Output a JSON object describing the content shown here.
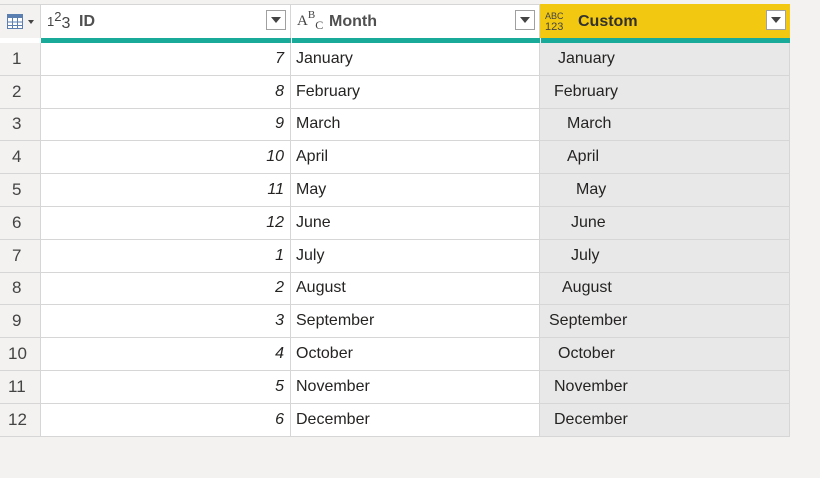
{
  "columns": [
    {
      "type_icon": "number-type-icon",
      "name": "ID"
    },
    {
      "type_icon": "text-type-icon",
      "name": "Month"
    },
    {
      "type_icon": "any-type-icon",
      "name": "Custom",
      "selected": true
    }
  ],
  "type_labels": {
    "number_a": "1",
    "number_b": "2",
    "number_c": "3",
    "text_a": "A",
    "text_b": "B",
    "text_c": "C",
    "any_top": "ABC",
    "any_bottom": "123"
  },
  "colors": {
    "selected_header": "#f2c811",
    "quality_bar": "#1aaa9a",
    "selected_column_bg": "#e8e8e8",
    "background": "#f3f2f1"
  },
  "rows": [
    {
      "n": "1",
      "id": "7",
      "month": "January",
      "custom": "January",
      "indent": 18
    },
    {
      "n": "2",
      "id": "8",
      "month": "February",
      "custom": "February",
      "indent": 14
    },
    {
      "n": "3",
      "id": "9",
      "month": "March",
      "custom": "March",
      "indent": 27
    },
    {
      "n": "4",
      "id": "10",
      "month": "April",
      "custom": "April",
      "indent": 27
    },
    {
      "n": "5",
      "id": "11",
      "month": "May",
      "custom": "May",
      "indent": 36
    },
    {
      "n": "6",
      "id": "12",
      "month": "June",
      "custom": "June",
      "indent": 31
    },
    {
      "n": "7",
      "id": "1",
      "month": "July",
      "custom": "July",
      "indent": 31
    },
    {
      "n": "8",
      "id": "2",
      "month": "August",
      "custom": "August",
      "indent": 22
    },
    {
      "n": "9",
      "id": "3",
      "month": "September",
      "custom": "September",
      "indent": 9
    },
    {
      "n": "10",
      "id": "4",
      "month": "October",
      "custom": "October",
      "indent": 18
    },
    {
      "n": "11",
      "id": "5",
      "month": "November",
      "custom": "November",
      "indent": 14
    },
    {
      "n": "12",
      "id": "6",
      "month": "December",
      "custom": "December",
      "indent": 14
    }
  ]
}
